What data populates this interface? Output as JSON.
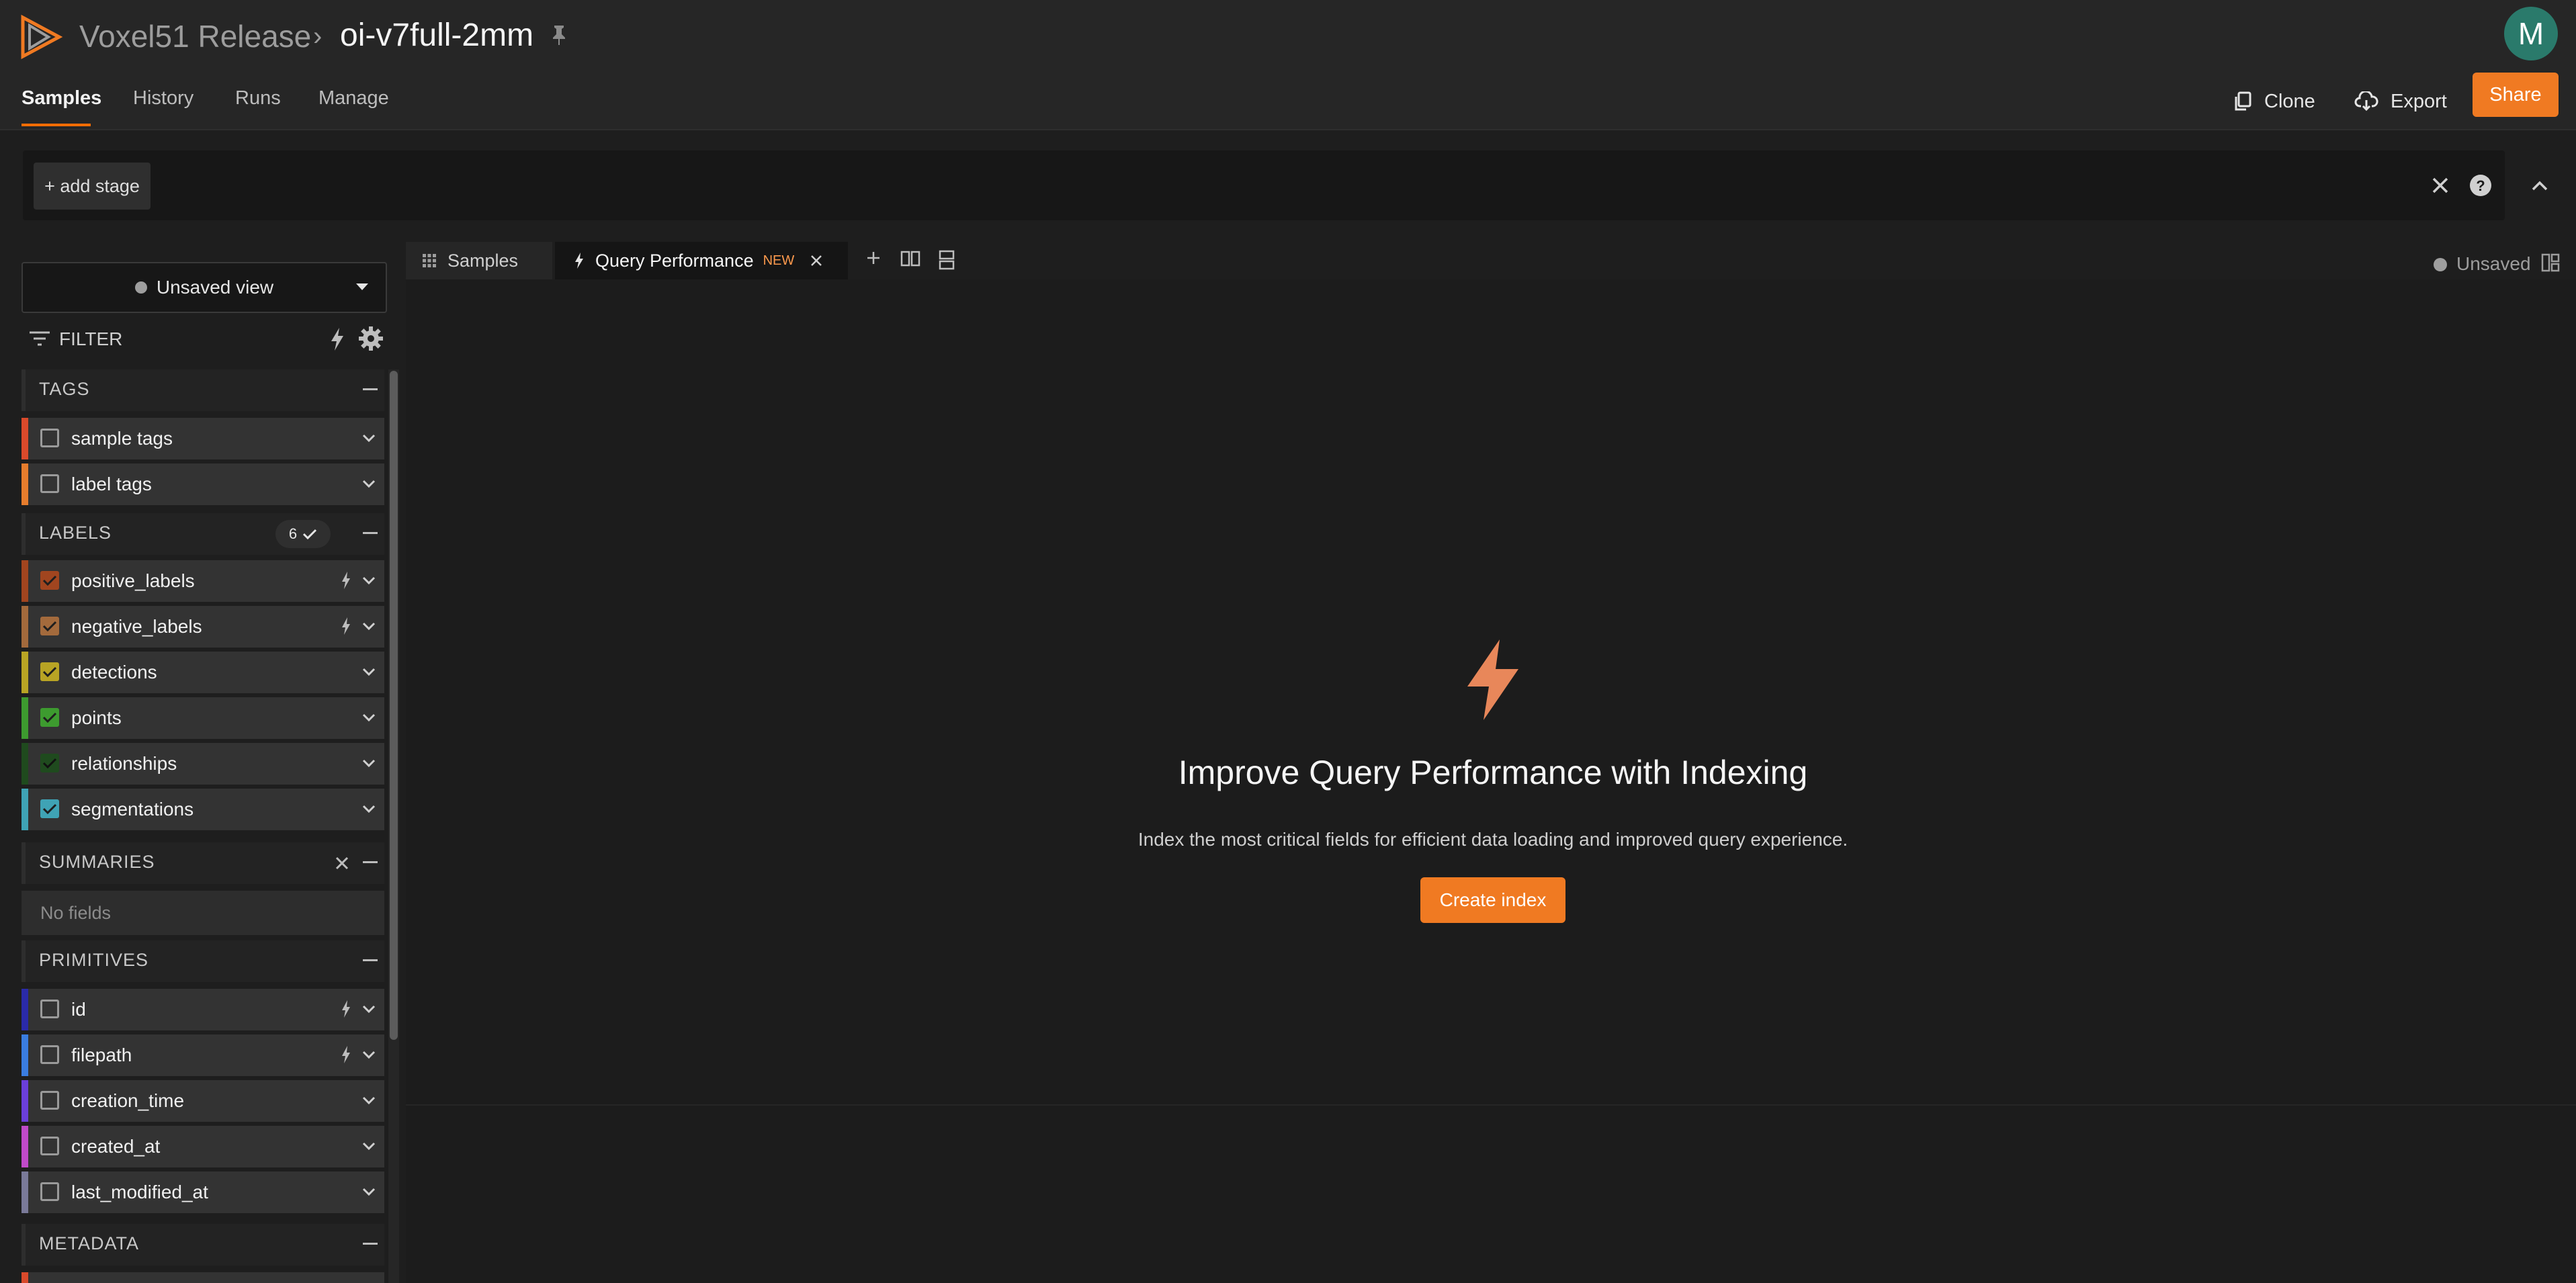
{
  "header": {
    "org": "Voxel51 Release",
    "breadcrumb_separator": "›",
    "dataset": "oi-v7full-2mm",
    "avatar_initial": "M"
  },
  "nav": {
    "tabs": [
      "Samples",
      "History",
      "Runs",
      "Manage"
    ],
    "active_tab": "Samples",
    "clone_label": "Clone",
    "export_label": "Export",
    "share_label": "Share"
  },
  "viewbar": {
    "add_stage": "+ add stage"
  },
  "sidebar": {
    "view_select": "Unsaved view",
    "filter_label": "FILTER",
    "groups": {
      "tags": {
        "title": "TAGS",
        "fields": [
          "sample tags",
          "label tags"
        ]
      },
      "labels": {
        "title": "LABELS",
        "count": "6",
        "fields": [
          "positive_labels",
          "negative_labels",
          "detections",
          "points",
          "relationships",
          "segmentations"
        ]
      },
      "summaries": {
        "title": "SUMMARIES",
        "empty": "No fields"
      },
      "primitives": {
        "title": "PRIMITIVES",
        "fields": [
          "id",
          "filepath",
          "creation_time",
          "created_at",
          "last_modified_at"
        ]
      },
      "metadata": {
        "title": "METADATA"
      }
    }
  },
  "panel_tabs": {
    "samples": "Samples",
    "query_performance": "Query Performance",
    "new_badge": "NEW",
    "unsaved": "Unsaved"
  },
  "query_performance": {
    "title": "Improve Query Performance with Indexing",
    "description": "Index the most critical fields for efficient data loading and improved query experience.",
    "button": "Create index"
  },
  "colors": {
    "accent": "#f07a22",
    "tag_sample": "#d94a2b",
    "tag_label": "#e67d2d",
    "positive_labels": "#a1451f",
    "negative_labels": "#a36a3c",
    "detections": "#b8a424",
    "points": "#3d9b2f",
    "relationships": "#1f4a1e",
    "segmentations": "#3fa3b5",
    "id": "#2a2aa8",
    "filepath": "#3a7de0",
    "creation_time": "#6b3fd9",
    "created_at": "#c04ac9",
    "last_modified_at": "#7a7a99"
  }
}
